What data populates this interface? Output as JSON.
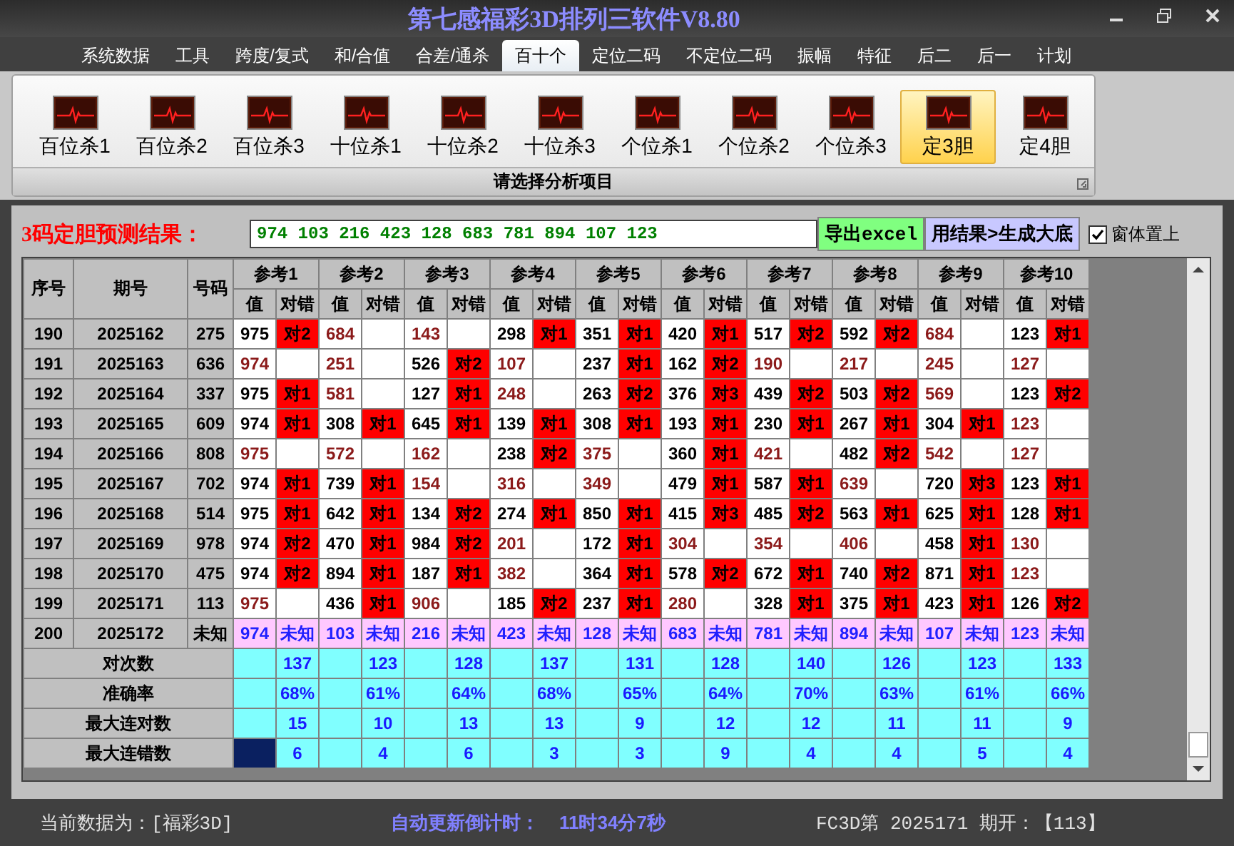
{
  "window": {
    "title": "第七感福彩3D排列三软件V8.80"
  },
  "menu_tabs": [
    {
      "label": "系统数据",
      "selected": false
    },
    {
      "label": "工具",
      "selected": false
    },
    {
      "label": "跨度/复式",
      "selected": false
    },
    {
      "label": "和/合值",
      "selected": false
    },
    {
      "label": "合差/通杀",
      "selected": false
    },
    {
      "label": "百十个",
      "selected": true
    },
    {
      "label": "定位二码",
      "selected": false
    },
    {
      "label": "不定位二码",
      "selected": false
    },
    {
      "label": "振幅",
      "selected": false
    },
    {
      "label": "特征",
      "selected": false
    },
    {
      "label": "后二",
      "selected": false
    },
    {
      "label": "后一",
      "selected": false
    },
    {
      "label": "计划",
      "selected": false
    }
  ],
  "ribbon": {
    "items": [
      {
        "label": "百位杀1",
        "selected": false
      },
      {
        "label": "百位杀2",
        "selected": false
      },
      {
        "label": "百位杀3",
        "selected": false
      },
      {
        "label": "十位杀1",
        "selected": false
      },
      {
        "label": "十位杀2",
        "selected": false
      },
      {
        "label": "十位杀3",
        "selected": false
      },
      {
        "label": "个位杀1",
        "selected": false
      },
      {
        "label": "个位杀2",
        "selected": false
      },
      {
        "label": "个位杀3",
        "selected": false
      },
      {
        "label": "定3胆",
        "selected": true
      },
      {
        "label": "定4胆",
        "selected": false
      }
    ],
    "caption": "请选择分析项目"
  },
  "result_bar": {
    "label": "3码定胆预测结果：",
    "value": "974 103 216 423 128 683 781 894 107 123",
    "buttons": [
      "导出excel",
      "用结果>生成大底"
    ],
    "stay_on_top": {
      "label": "窗体置上",
      "checked": true
    }
  },
  "table": {
    "columns": [
      "序号",
      "期号",
      "号码"
    ],
    "ref_groups": [
      {
        "label": "参考1",
        "sub_columns": [
          "值",
          "对错"
        ]
      },
      {
        "label": "参考2",
        "sub_columns": [
          "值",
          "对错"
        ]
      },
      {
        "label": "参考3",
        "sub_columns": [
          "值",
          "对错"
        ]
      },
      {
        "label": "参考4",
        "sub_columns": [
          "值",
          "对错"
        ]
      },
      {
        "label": "参考5",
        "sub_columns": [
          "值",
          "对错"
        ]
      },
      {
        "label": "参考6",
        "sub_columns": [
          "值",
          "对错"
        ]
      },
      {
        "label": "参考7",
        "sub_columns": [
          "值",
          "对错"
        ]
      },
      {
        "label": "参考8",
        "sub_columns": [
          "值",
          "对错"
        ]
      },
      {
        "label": "参考9",
        "sub_columns": [
          "值",
          "对错"
        ]
      },
      {
        "label": "参考10",
        "sub_columns": [
          "值",
          "对错"
        ]
      }
    ],
    "rows": [
      {
        "seq": "190",
        "period": "2025162",
        "number": "275",
        "kind": "history",
        "refs": [
          {
            "value": "975",
            "result": "对2",
            "hit": true
          },
          {
            "value": "684",
            "hit": false
          },
          {
            "value": "143",
            "hit": false
          },
          {
            "value": "298",
            "result": "对1",
            "hit": true
          },
          {
            "value": "351",
            "result": "对1",
            "hit": true
          },
          {
            "value": "420",
            "result": "对1",
            "hit": true
          },
          {
            "value": "517",
            "result": "对2",
            "hit": true
          },
          {
            "value": "592",
            "result": "对2",
            "hit": true
          },
          {
            "value": "684",
            "hit": false
          },
          {
            "value": "123",
            "result": "对1",
            "hit": true
          }
        ]
      },
      {
        "seq": "191",
        "period": "2025163",
        "number": "636",
        "kind": "history",
        "refs": [
          {
            "value": "974",
            "hit": false
          },
          {
            "value": "251",
            "hit": false
          },
          {
            "value": "526",
            "result": "对2",
            "hit": true
          },
          {
            "value": "107",
            "hit": false
          },
          {
            "value": "237",
            "result": "对1",
            "hit": true
          },
          {
            "value": "162",
            "result": "对2",
            "hit": true
          },
          {
            "value": "190",
            "hit": false
          },
          {
            "value": "217",
            "hit": false
          },
          {
            "value": "245",
            "hit": false
          },
          {
            "value": "127",
            "hit": false
          }
        ]
      },
      {
        "seq": "192",
        "period": "2025164",
        "number": "337",
        "kind": "history",
        "refs": [
          {
            "value": "975",
            "result": "对1",
            "hit": true
          },
          {
            "value": "581",
            "hit": false
          },
          {
            "value": "127",
            "result": "对1",
            "hit": true
          },
          {
            "value": "248",
            "hit": false
          },
          {
            "value": "263",
            "result": "对2",
            "hit": true
          },
          {
            "value": "376",
            "result": "对3",
            "hit": true
          },
          {
            "value": "439",
            "result": "对2",
            "hit": true
          },
          {
            "value": "503",
            "result": "对2",
            "hit": true
          },
          {
            "value": "569",
            "hit": false
          },
          {
            "value": "123",
            "result": "对2",
            "hit": true
          }
        ]
      },
      {
        "seq": "193",
        "period": "2025165",
        "number": "609",
        "kind": "history",
        "refs": [
          {
            "value": "974",
            "result": "对1",
            "hit": true
          },
          {
            "value": "308",
            "result": "对1",
            "hit": true
          },
          {
            "value": "645",
            "result": "对1",
            "hit": true
          },
          {
            "value": "139",
            "result": "对1",
            "hit": true
          },
          {
            "value": "308",
            "result": "对1",
            "hit": true
          },
          {
            "value": "193",
            "result": "对1",
            "hit": true
          },
          {
            "value": "230",
            "result": "对1",
            "hit": true
          },
          {
            "value": "267",
            "result": "对1",
            "hit": true
          },
          {
            "value": "304",
            "result": "对1",
            "hit": true
          },
          {
            "value": "123",
            "hit": false
          }
        ]
      },
      {
        "seq": "194",
        "period": "2025166",
        "number": "808",
        "kind": "history",
        "refs": [
          {
            "value": "975",
            "hit": false
          },
          {
            "value": "572",
            "hit": false
          },
          {
            "value": "162",
            "hit": false
          },
          {
            "value": "238",
            "result": "对2",
            "hit": true
          },
          {
            "value": "375",
            "hit": false
          },
          {
            "value": "360",
            "result": "对1",
            "hit": true
          },
          {
            "value": "421",
            "hit": false
          },
          {
            "value": "482",
            "result": "对2",
            "hit": true
          },
          {
            "value": "542",
            "hit": false
          },
          {
            "value": "127",
            "hit": false
          }
        ]
      },
      {
        "seq": "195",
        "period": "2025167",
        "number": "702",
        "kind": "history",
        "refs": [
          {
            "value": "974",
            "result": "对1",
            "hit": true
          },
          {
            "value": "739",
            "result": "对1",
            "hit": true
          },
          {
            "value": "154",
            "hit": false
          },
          {
            "value": "316",
            "hit": false
          },
          {
            "value": "349",
            "hit": false
          },
          {
            "value": "479",
            "result": "对1",
            "hit": true
          },
          {
            "value": "587",
            "result": "对1",
            "hit": true
          },
          {
            "value": "639",
            "hit": false
          },
          {
            "value": "720",
            "result": "对3",
            "hit": true
          },
          {
            "value": "123",
            "result": "对1",
            "hit": true
          }
        ]
      },
      {
        "seq": "196",
        "period": "2025168",
        "number": "514",
        "kind": "history",
        "refs": [
          {
            "value": "975",
            "result": "对1",
            "hit": true
          },
          {
            "value": "642",
            "result": "对1",
            "hit": true
          },
          {
            "value": "134",
            "result": "对2",
            "hit": true
          },
          {
            "value": "274",
            "result": "对1",
            "hit": true
          },
          {
            "value": "850",
            "result": "对1",
            "hit": true
          },
          {
            "value": "415",
            "result": "对3",
            "hit": true
          },
          {
            "value": "485",
            "result": "对2",
            "hit": true
          },
          {
            "value": "563",
            "result": "对1",
            "hit": true
          },
          {
            "value": "625",
            "result": "对1",
            "hit": true
          },
          {
            "value": "128",
            "result": "对1",
            "hit": true
          }
        ]
      },
      {
        "seq": "197",
        "period": "2025169",
        "number": "978",
        "kind": "history",
        "refs": [
          {
            "value": "974",
            "result": "对2",
            "hit": true
          },
          {
            "value": "470",
            "result": "对1",
            "hit": true
          },
          {
            "value": "984",
            "result": "对2",
            "hit": true
          },
          {
            "value": "201",
            "hit": false
          },
          {
            "value": "172",
            "result": "对1",
            "hit": true
          },
          {
            "value": "304",
            "hit": false
          },
          {
            "value": "354",
            "hit": false
          },
          {
            "value": "406",
            "hit": false
          },
          {
            "value": "458",
            "result": "对1",
            "hit": true
          },
          {
            "value": "130",
            "hit": false
          }
        ]
      },
      {
        "seq": "198",
        "period": "2025170",
        "number": "475",
        "kind": "history",
        "refs": [
          {
            "value": "974",
            "result": "对2",
            "hit": true
          },
          {
            "value": "894",
            "result": "对1",
            "hit": true
          },
          {
            "value": "187",
            "result": "对1",
            "hit": true
          },
          {
            "value": "382",
            "hit": false
          },
          {
            "value": "364",
            "result": "对1",
            "hit": true
          },
          {
            "value": "578",
            "result": "对2",
            "hit": true
          },
          {
            "value": "672",
            "result": "对1",
            "hit": true
          },
          {
            "value": "740",
            "result": "对2",
            "hit": true
          },
          {
            "value": "871",
            "result": "对1",
            "hit": true
          },
          {
            "value": "123",
            "hit": false
          }
        ]
      },
      {
        "seq": "199",
        "period": "2025171",
        "number": "113",
        "kind": "history",
        "refs": [
          {
            "value": "975",
            "hit": false
          },
          {
            "value": "436",
            "result": "对1",
            "hit": true
          },
          {
            "value": "906",
            "hit": false
          },
          {
            "value": "185",
            "result": "对2",
            "hit": true
          },
          {
            "value": "237",
            "result": "对1",
            "hit": true
          },
          {
            "value": "280",
            "hit": false
          },
          {
            "value": "328",
            "result": "对1",
            "hit": true
          },
          {
            "value": "375",
            "result": "对1",
            "hit": true
          },
          {
            "value": "423",
            "result": "对1",
            "hit": true
          },
          {
            "value": "126",
            "result": "对2",
            "hit": true
          }
        ]
      },
      {
        "seq": "200",
        "period": "2025172",
        "number": "未知",
        "kind": "forecast",
        "refs": [
          {
            "value": "974",
            "result": "未知"
          },
          {
            "value": "103",
            "result": "未知"
          },
          {
            "value": "216",
            "result": "未知"
          },
          {
            "value": "423",
            "result": "未知"
          },
          {
            "value": "128",
            "result": "未知"
          },
          {
            "value": "683",
            "result": "未知"
          },
          {
            "value": "781",
            "result": "未知"
          },
          {
            "value": "894",
            "result": "未知"
          },
          {
            "value": "107",
            "result": "未知"
          },
          {
            "value": "123",
            "result": "未知"
          }
        ]
      }
    ],
    "summary_rows": [
      {
        "label": "对次数",
        "selected": false,
        "values": [
          "137",
          "123",
          "128",
          "137",
          "131",
          "128",
          "140",
          "126",
          "123",
          "133"
        ]
      },
      {
        "label": "准确率",
        "selected": false,
        "values": [
          "68%",
          "61%",
          "64%",
          "68%",
          "65%",
          "64%",
          "70%",
          "63%",
          "61%",
          "66%"
        ]
      },
      {
        "label": "最大连对数",
        "selected": false,
        "values": [
          "15",
          "10",
          "13",
          "13",
          "9",
          "12",
          "12",
          "11",
          "11",
          "9"
        ]
      },
      {
        "label": "最大连错数",
        "selected": true,
        "values": [
          "6",
          "4",
          "6",
          "3",
          "3",
          "9",
          "4",
          "4",
          "5",
          "4"
        ]
      }
    ]
  },
  "status_bar": {
    "current_data": "当前数据为：[福彩3D]",
    "countdown_label": "自动更新倒计时：",
    "countdown": "11时34分7秒",
    "draw_info": "FC3D第 2025171 期开：【113】"
  }
}
